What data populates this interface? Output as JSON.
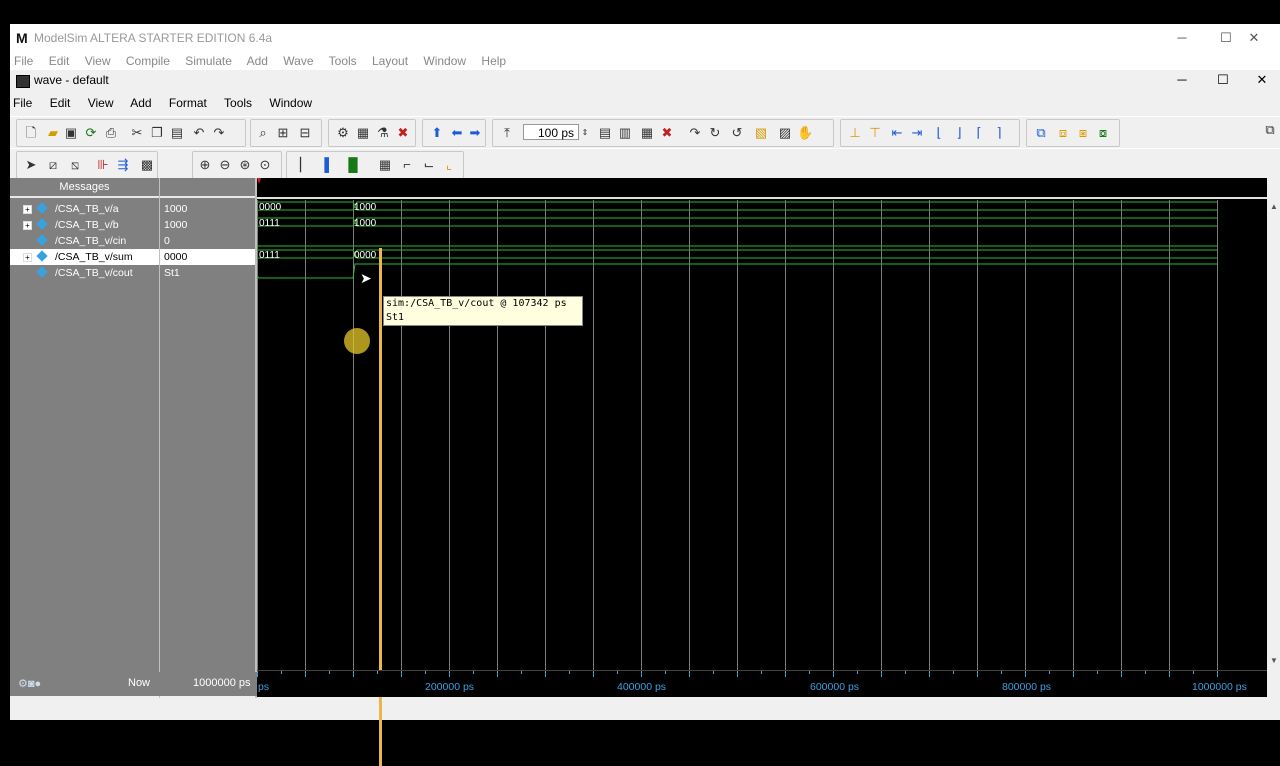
{
  "main_window": {
    "title": "ModelSim ALTERA STARTER EDITION 6.4a",
    "menu": [
      "File",
      "Edit",
      "View",
      "Compile",
      "Simulate",
      "Add",
      "Wave",
      "Tools",
      "Layout",
      "Window",
      "Help"
    ]
  },
  "wave_window": {
    "title": "wave - default",
    "menu": [
      "File",
      "Edit",
      "View",
      "Add",
      "Format",
      "Tools",
      "Window"
    ]
  },
  "toolbar": {
    "time_step": "100 ps"
  },
  "panes": {
    "messages_header": "Messages",
    "signals": [
      {
        "name": "/CSA_TB_v/a",
        "value": "1000",
        "expandable": true
      },
      {
        "name": "/CSA_TB_v/b",
        "value": "1000",
        "expandable": true
      },
      {
        "name": "/CSA_TB_v/cin",
        "value": "0",
        "expandable": false
      },
      {
        "name": "/CSA_TB_v/sum",
        "value": "0000",
        "expandable": true,
        "selected": true
      },
      {
        "name": "/CSA_TB_v/cout",
        "value": "St1",
        "expandable": false
      }
    ]
  },
  "wave_values": {
    "a": [
      "0000",
      "1000"
    ],
    "b": [
      "0111",
      "1000"
    ],
    "sum": [
      "0111",
      "0000"
    ]
  },
  "tooltip": {
    "line1": "sim:/CSA_TB_v/cout @ 107342 ps",
    "line2": "St1"
  },
  "status": {
    "now_label": "Now",
    "now_value": "1000000 ps"
  },
  "timeline": {
    "start_label": "ps",
    "ticks": [
      "200000 ps",
      "400000 ps",
      "600000 ps",
      "800000 ps",
      "1000000 ps"
    ]
  },
  "colors": {
    "wave": "#2fb52f",
    "cursor": "#e8b84a",
    "diamond": "#36a3e0",
    "pane": "#808080"
  }
}
